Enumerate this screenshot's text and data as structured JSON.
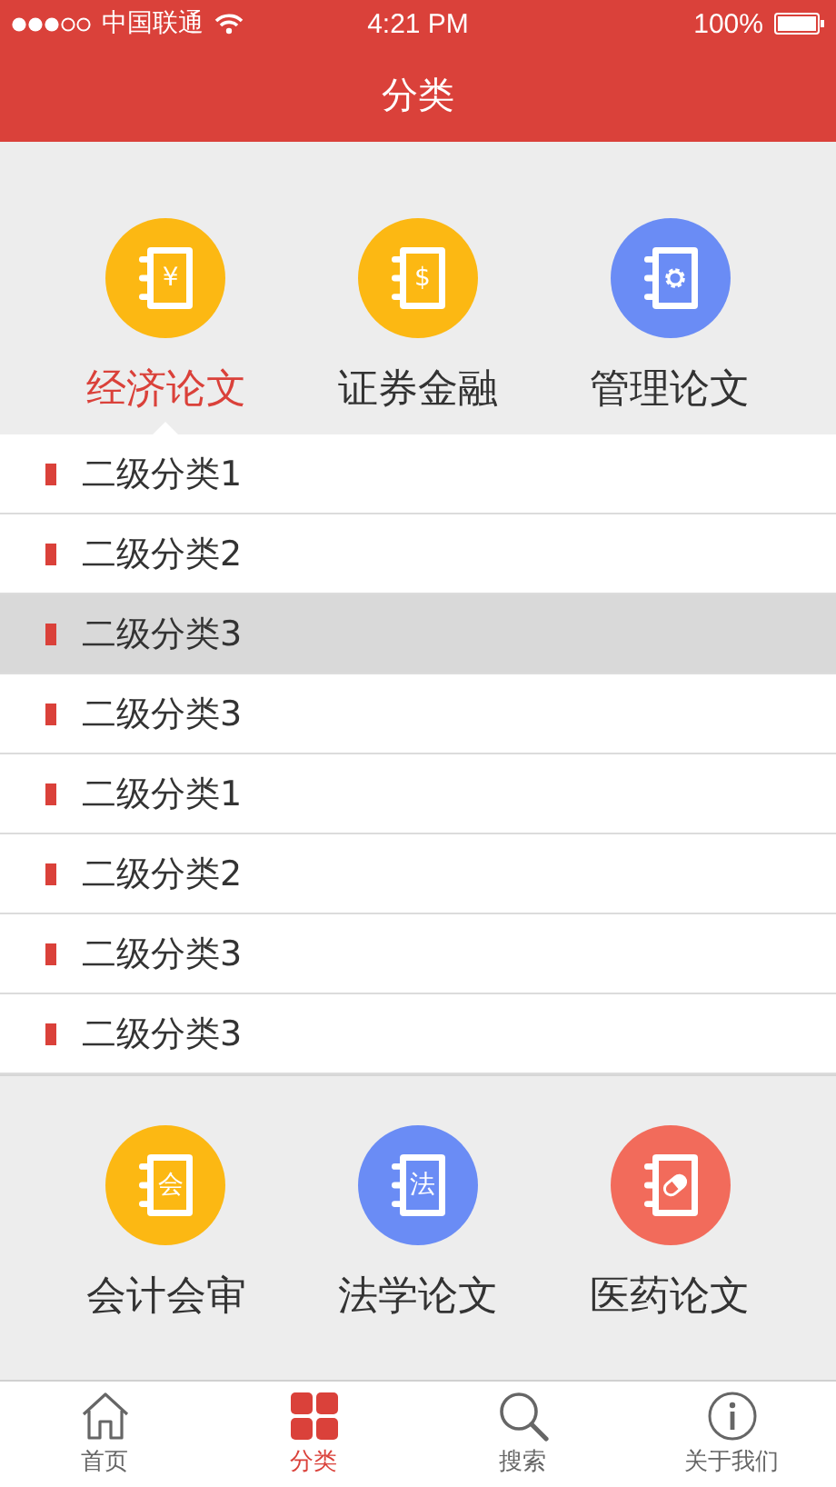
{
  "status_bar": {
    "carrier": "中国联通",
    "time": "4:21 PM",
    "battery": "100%"
  },
  "header": {
    "title": "分类"
  },
  "categories": [
    {
      "label": "经济论文",
      "kind": "glyph",
      "glyph": "¥",
      "color": "#fcb813",
      "selected": true
    },
    {
      "label": "证券金融",
      "kind": "glyph",
      "glyph": "$",
      "color": "#fcb813",
      "selected": false
    },
    {
      "label": "管理论文",
      "kind": "gear",
      "color": "#6a8cf5",
      "selected": false
    }
  ],
  "subcategories": [
    {
      "label": "二级分类1",
      "selected": false
    },
    {
      "label": "二级分类2",
      "selected": false
    },
    {
      "label": "二级分类3",
      "selected": true
    },
    {
      "label": "二级分类3",
      "selected": false
    },
    {
      "label": "二级分类1",
      "selected": false
    },
    {
      "label": "二级分类2",
      "selected": false
    },
    {
      "label": "二级分类3",
      "selected": false
    },
    {
      "label": "二级分类3",
      "selected": false
    }
  ],
  "more_categories": [
    {
      "label": "会计会审",
      "kind": "glyph",
      "glyph": "会",
      "color": "#fcb813",
      "selected": false
    },
    {
      "label": "法学论文",
      "kind": "glyph",
      "glyph": "法",
      "color": "#6a8cf5",
      "selected": false
    },
    {
      "label": "医药论文",
      "kind": "pill",
      "color": "#f26b5b",
      "selected": false
    }
  ],
  "tab_bar": [
    {
      "label": "首页",
      "kind": "home",
      "selected": false
    },
    {
      "label": "分类",
      "kind": "grid",
      "selected": true
    },
    {
      "label": "搜索",
      "kind": "search",
      "selected": false
    },
    {
      "label": "关于我们",
      "kind": "info",
      "selected": false
    }
  ]
}
